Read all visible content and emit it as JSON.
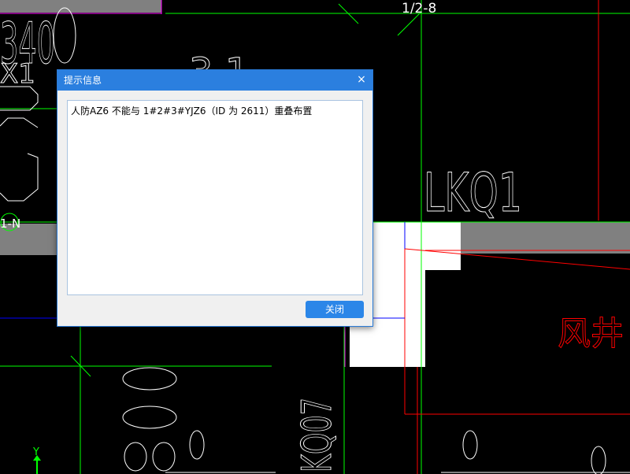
{
  "canvas": {
    "axis_label_top": "1/2-8",
    "label_left_axis": "1-N",
    "label_lkq": "LKQ1",
    "label_vertical_kq": "KQ07",
    "label_fengjing": "风井",
    "label_y_axis": "Y",
    "label_big_top_left": "340",
    "label_small_left": "X1",
    "label_partial_top": "3 1",
    "label_oval_stack": "800",
    "colors": {
      "background": "#000000",
      "green": "#00ff00",
      "red": "#ff0000",
      "blue": "#0000ff",
      "white": "#ffffff",
      "gray": "#808080",
      "magenta": "#ff00ff"
    }
  },
  "dialog": {
    "title": "提示信息",
    "close_glyph": "×",
    "message": "人防AZ6 不能与 1#2#3#YJZ6（ID 为 2611）重叠布置",
    "close_button_label": "关闭",
    "colors": {
      "titlebar": "#2b7fdf",
      "button": "#2b86e8"
    }
  }
}
